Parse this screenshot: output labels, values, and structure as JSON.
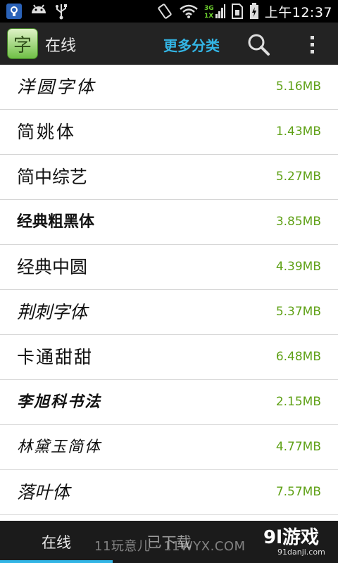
{
  "status_bar": {
    "network": "3G 1X",
    "time": "上午12:37"
  },
  "action_bar": {
    "logo_char": "字",
    "title": "在线",
    "more_label": "更多分类"
  },
  "fonts": [
    {
      "name": "洋圆字体",
      "size": "5.16MB"
    },
    {
      "name": "简姚体",
      "size": "1.43MB"
    },
    {
      "name": "简中综艺",
      "size": "5.27MB"
    },
    {
      "name": "经典粗黑体",
      "size": "3.85MB"
    },
    {
      "name": "经典中圆",
      "size": "4.39MB"
    },
    {
      "name": "荆刺字体",
      "size": "5.37MB"
    },
    {
      "name": "卡通甜甜",
      "size": "6.48MB"
    },
    {
      "name": "李旭科书法",
      "size": "2.15MB"
    },
    {
      "name": "林黛玉简体",
      "size": "4.77MB"
    },
    {
      "name": "落叶体",
      "size": "7.57MB"
    }
  ],
  "tabs": {
    "online": "在线",
    "downloaded": "已下载"
  },
  "watermark": {
    "left": "11玩意儿 · 11WYX.COM",
    "right_main": "9l游戏",
    "right_sub": "91danji.com"
  },
  "colors": {
    "accent": "#33b5e5",
    "size_text": "#5fa116",
    "action_bar": "#232323"
  }
}
